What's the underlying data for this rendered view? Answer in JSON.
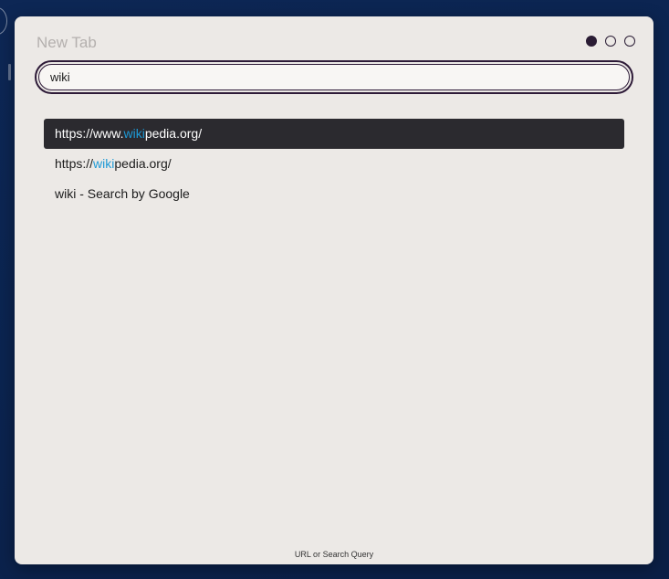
{
  "window": {
    "title": "New Tab"
  },
  "window_controls": [
    "filled",
    "empty",
    "empty"
  ],
  "search": {
    "value": "wiki",
    "highlight_color": "#1e9ad6"
  },
  "results": [
    {
      "prefix": "https://www.",
      "highlight": "wiki",
      "suffix": "pedia.org/",
      "selected": true
    },
    {
      "prefix": "https://",
      "highlight": "wiki",
      "suffix": "pedia.org/",
      "selected": false
    },
    {
      "prefix": "wiki - Search by Google",
      "highlight": "",
      "suffix": "",
      "selected": false
    }
  ],
  "footer": {
    "hint": "URL or Search Query"
  },
  "colors": {
    "panel_bg": "#ece9e6",
    "selected_bg": "#2b2a2f",
    "accent_dark": "#2e1b38",
    "desktop_bg": "#0b2450"
  }
}
